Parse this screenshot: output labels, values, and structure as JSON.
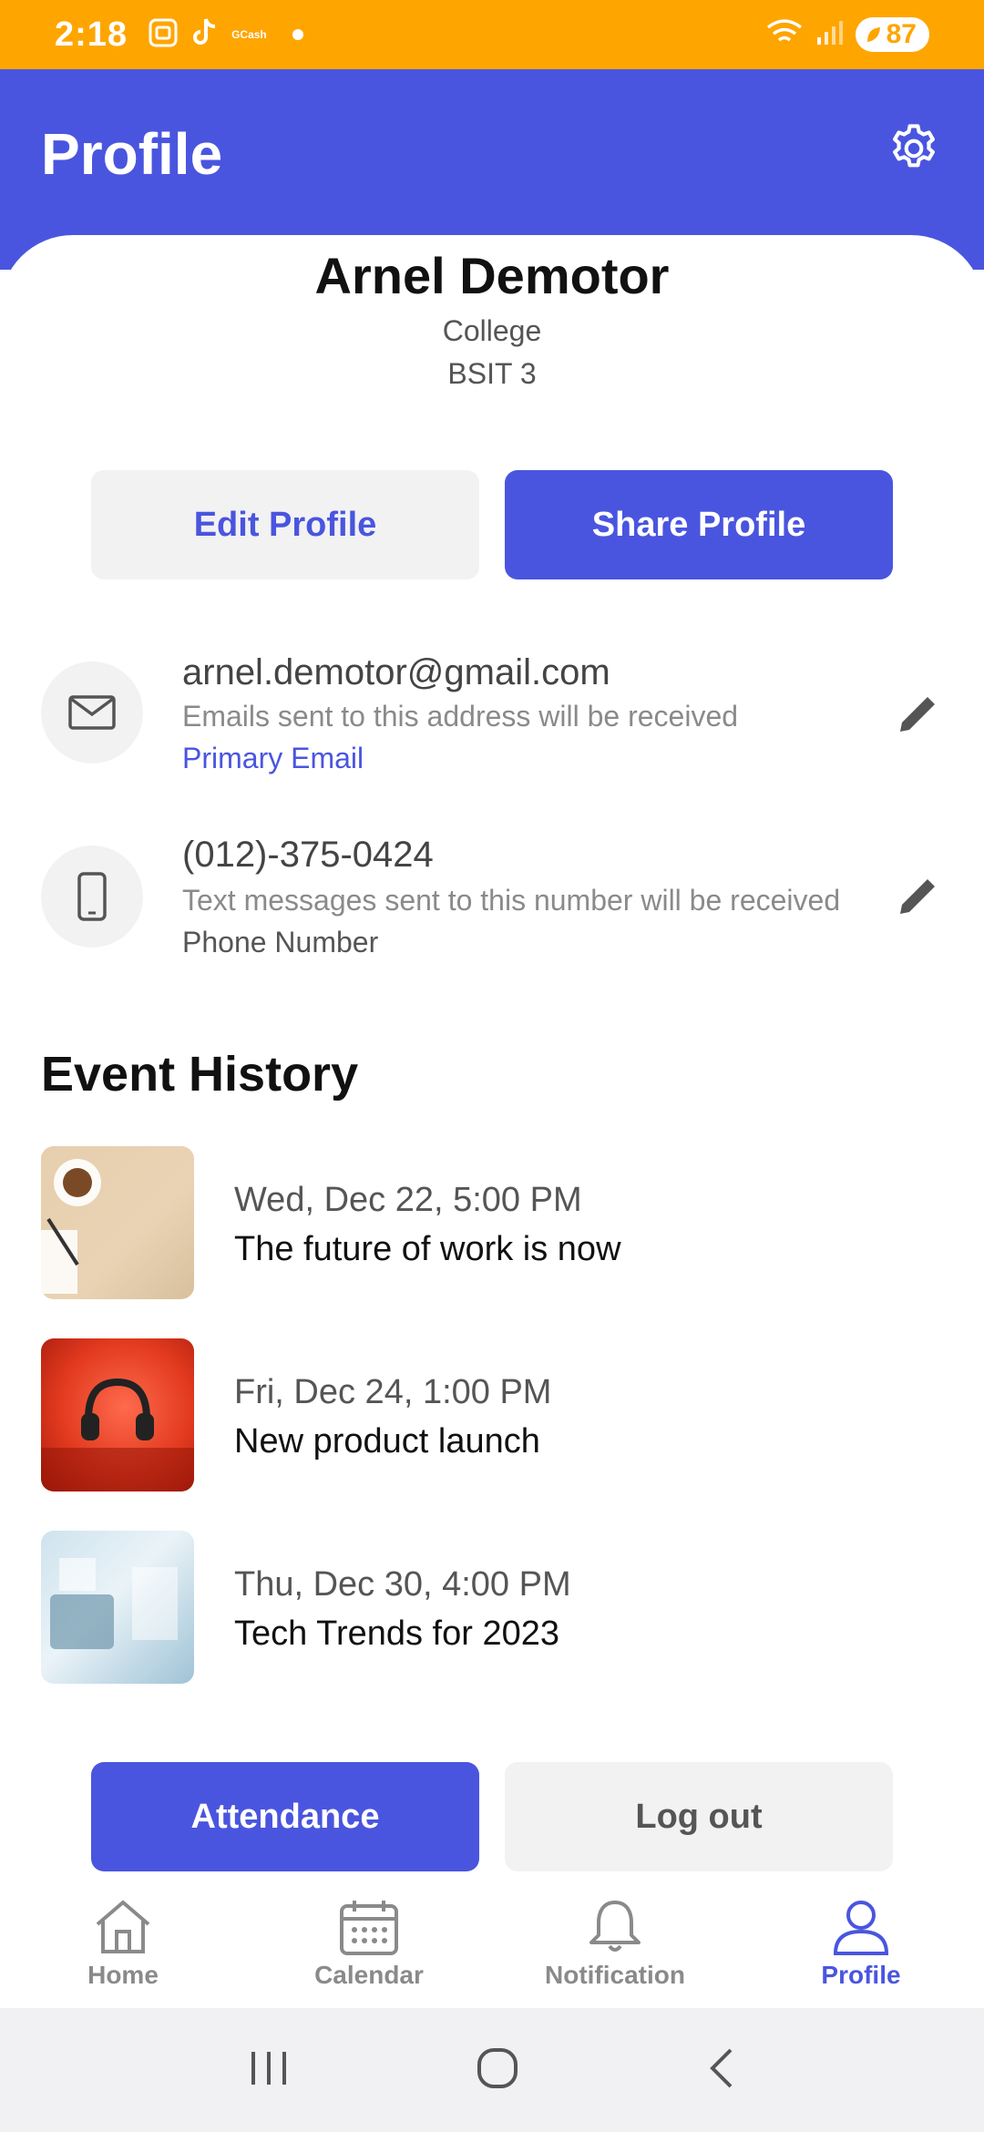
{
  "status_bar": {
    "time": "2:18",
    "apps": [
      "screenshot-icon",
      "tiktok-icon",
      "gcash-icon"
    ],
    "gcash_label": "GCash",
    "battery": "87"
  },
  "header": {
    "title": "Profile",
    "settings_icon": "gear-icon"
  },
  "user": {
    "name": "Arnel Demotor",
    "level": "College",
    "course": "BSIT 3"
  },
  "actions": {
    "edit_profile": "Edit Profile",
    "share_profile": "Share Profile"
  },
  "contacts": [
    {
      "icon": "mail-icon",
      "value": "arnel.demotor@gmail.com",
      "description": "Emails sent to this address will be received",
      "tag": "Primary Email",
      "tag_color": "#4A55DF"
    },
    {
      "icon": "phone-icon",
      "value": "(012)-375-0424",
      "description": "Text messages sent to this number will be received",
      "tag": "Phone Number",
      "tag_color": "#555555"
    }
  ],
  "event_history": {
    "title": "Event History",
    "events": [
      {
        "date": "Wed, Dec 22, 5:00 PM",
        "title": "The future of work is now"
      },
      {
        "date": "Fri, Dec 24, 1:00 PM",
        "title": "New product launch"
      },
      {
        "date": "Thu, Dec 30, 4:00 PM",
        "title": "Tech Trends for 2023"
      }
    ]
  },
  "bottom_actions": {
    "attendance": "Attendance",
    "logout": "Log out"
  },
  "bottom_nav": [
    {
      "label": "Home",
      "icon": "home-icon",
      "active": false
    },
    {
      "label": "Calendar",
      "icon": "calendar-icon",
      "active": false
    },
    {
      "label": "Notification",
      "icon": "bell-icon",
      "active": false
    },
    {
      "label": "Profile",
      "icon": "user-icon",
      "active": true
    }
  ],
  "colors": {
    "accent": "#4A55DF",
    "status_bar": "#FFA500",
    "light_button": "#F2F2F3"
  }
}
